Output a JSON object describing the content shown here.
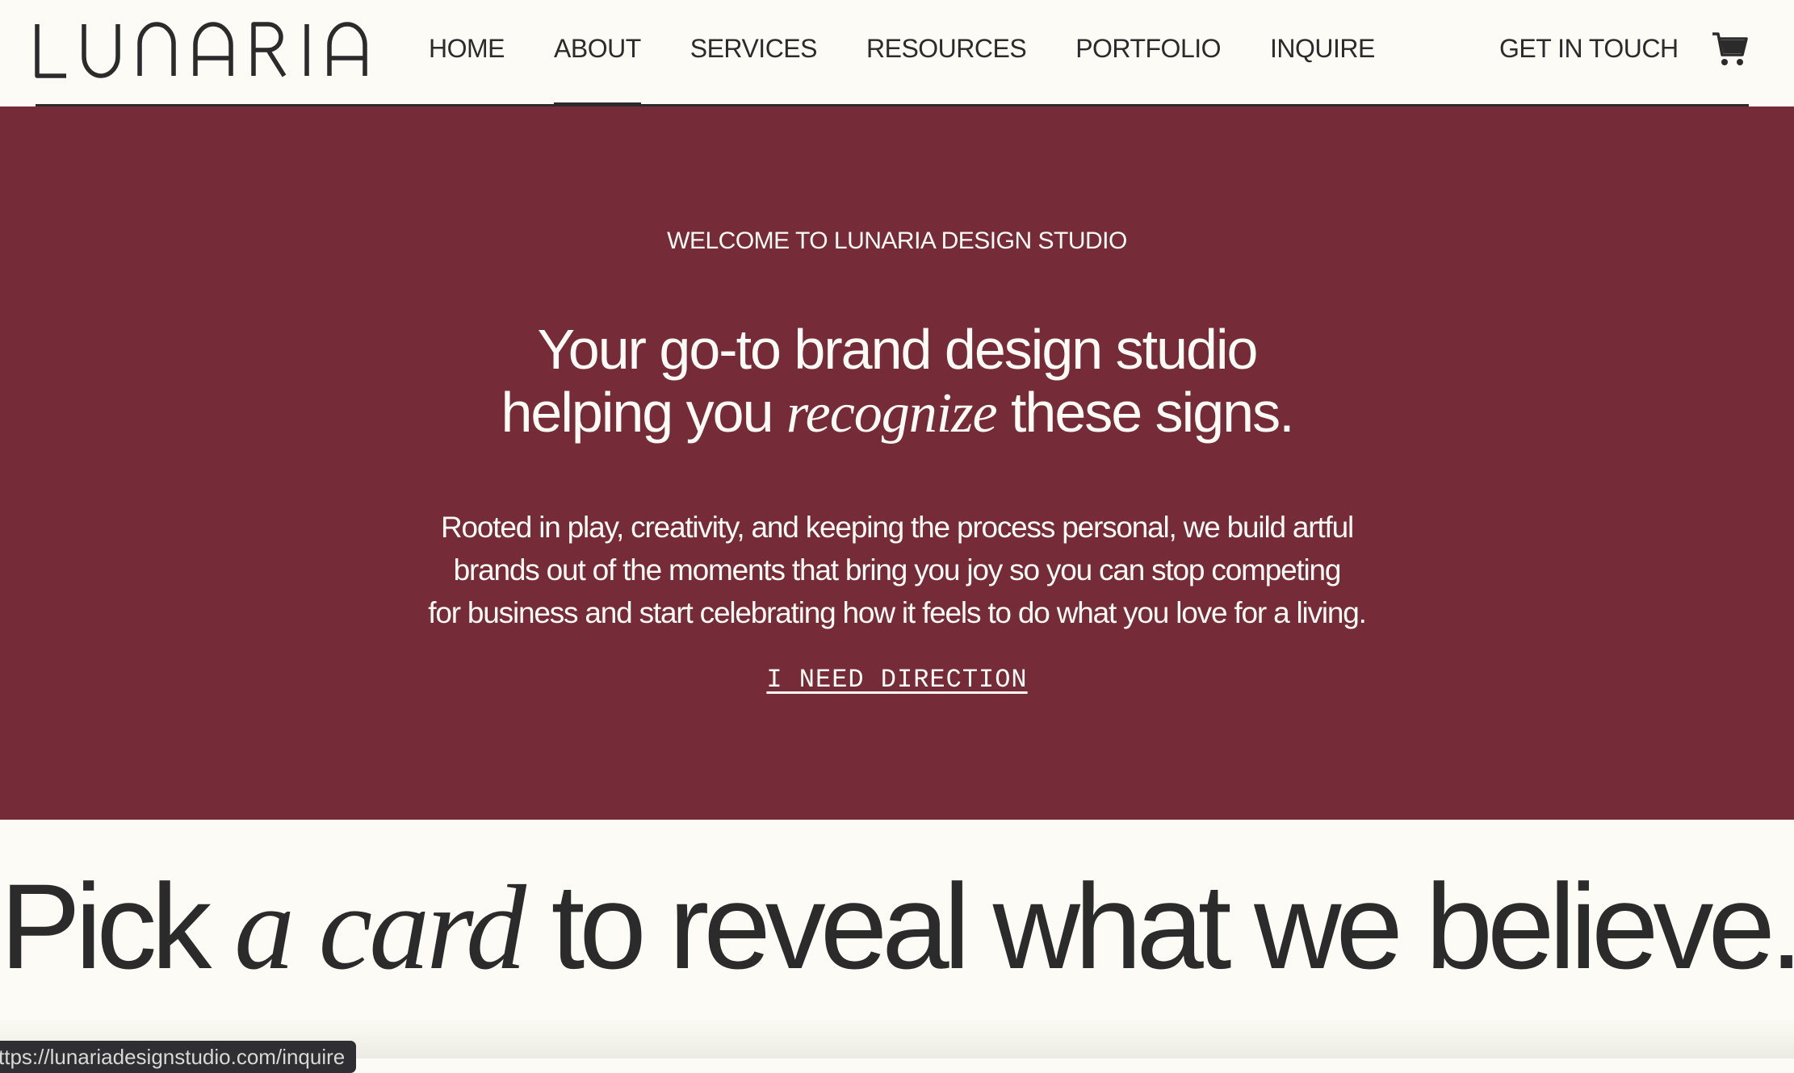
{
  "header": {
    "logo_text": "LUNARIA",
    "nav": [
      {
        "label": "HOME",
        "active": false
      },
      {
        "label": "ABOUT",
        "active": true
      },
      {
        "label": "SERVICES",
        "active": false
      },
      {
        "label": "RESOURCES",
        "active": false
      },
      {
        "label": "PORTFOLIO",
        "active": false
      },
      {
        "label": "INQUIRE",
        "active": false
      }
    ],
    "cta_label": "GET IN TOUCH",
    "cart_icon": "cart-icon"
  },
  "hero": {
    "eyebrow": "WELCOME TO LUNARIA DESIGN STUDIO",
    "title_line1": "Your go-to brand design studio",
    "title_line2_before": "helping you ",
    "title_line2_accent": "recognize",
    "title_line2_after": " these signs.",
    "body_line1": "Rooted in play, creativity, and keeping the process personal, we build artful",
    "body_line2": "brands out of the moments that bring you joy so you can stop competing",
    "body_line3": "for business and start celebrating how it feels to do what you love for a living.",
    "cta_label": "I NEED DIRECTION"
  },
  "beliefs": {
    "heading_before": "Pick ",
    "heading_accent": "a card",
    "heading_after": " to reveal what we believe..."
  },
  "status_bar": {
    "url": "ttps://lunariadesignstudio.com/inquire"
  },
  "colors": {
    "hero_background": "#762b39",
    "page_background": "#fcfbf5",
    "text_dark": "#2b2b2b",
    "text_light": "#fcfbf5"
  }
}
